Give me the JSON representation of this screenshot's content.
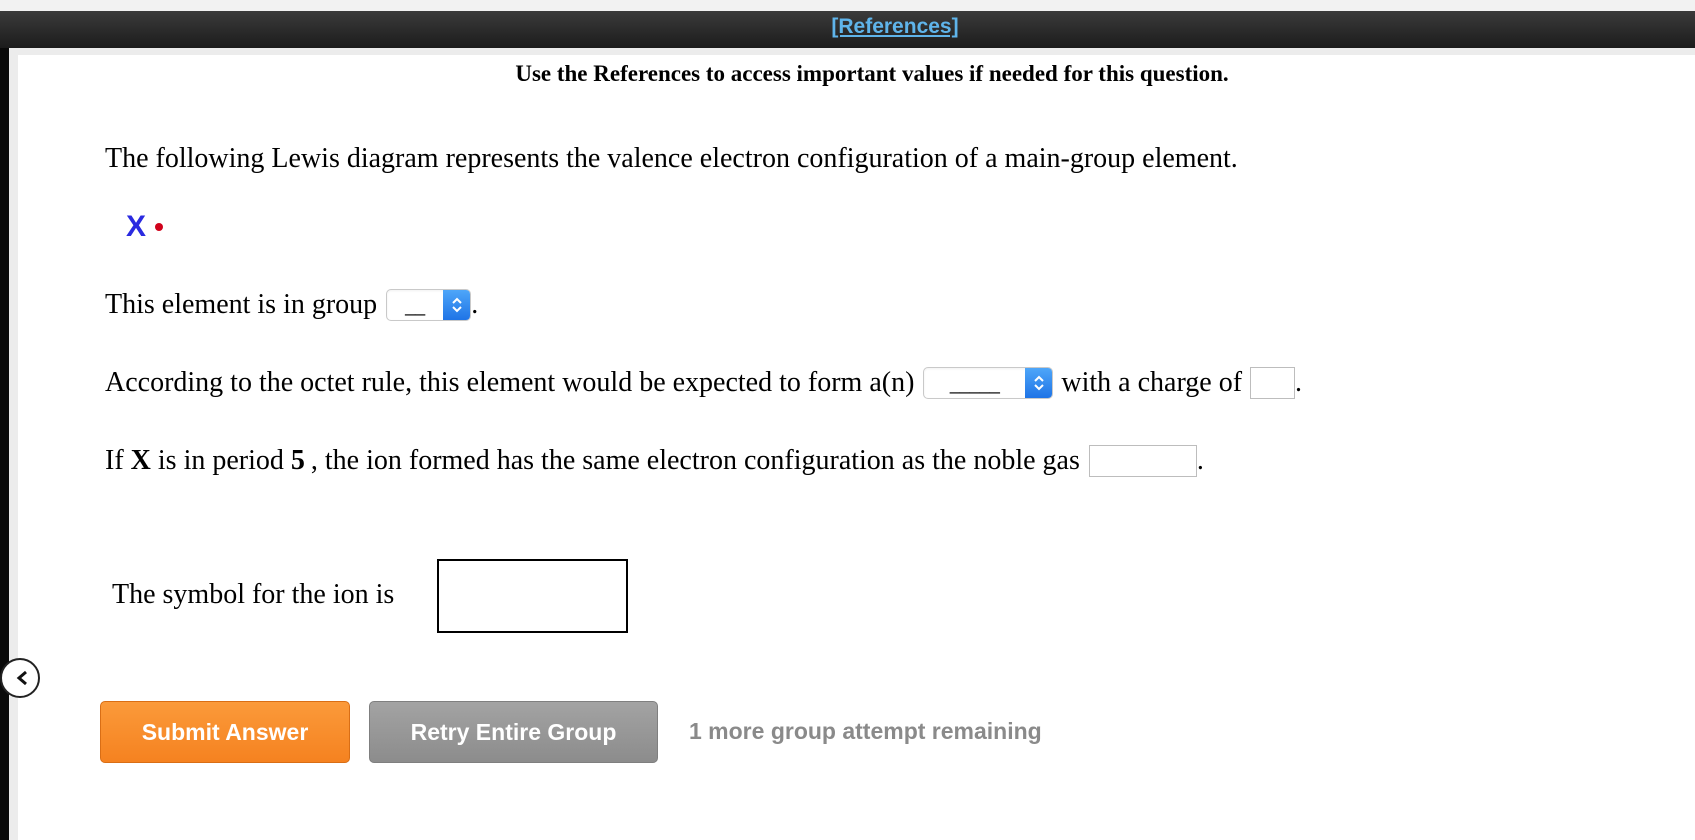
{
  "references_link": "[References]",
  "instructions": "Use the References to access important values if needed for this question.",
  "question": {
    "intro": "The following Lewis diagram represents the valence electron configuration of a main-group element.",
    "lewis_symbol": "X",
    "group_prefix": "This element is in group",
    "group_select_value": "__",
    "group_suffix": ".",
    "octet_prefix": "According to the octet rule, this element would be expected to form a(n)",
    "ion_type_select_value": "_____",
    "charge_text": "with a charge of",
    "charge_suffix": ".",
    "period_if": "If",
    "period_x": "X",
    "period_mid": "is in period",
    "period_num": "5",
    "period_rest": ", the ion formed has the same electron configuration as the noble gas",
    "period_suffix": ".",
    "symbol_prefix": "The symbol for the ion is"
  },
  "buttons": {
    "submit": "Submit Answer",
    "retry": "Retry Entire Group"
  },
  "attempts_text": "1 more group attempt remaining",
  "colors": {
    "reference_link": "#5fb4ea",
    "lewis_symbol": "#2a2ae0",
    "lewis_dot": "#d0021b",
    "submit_button": "#f58220",
    "retry_button": "#9a9a9a",
    "select_arrow": "#2f86f0"
  }
}
